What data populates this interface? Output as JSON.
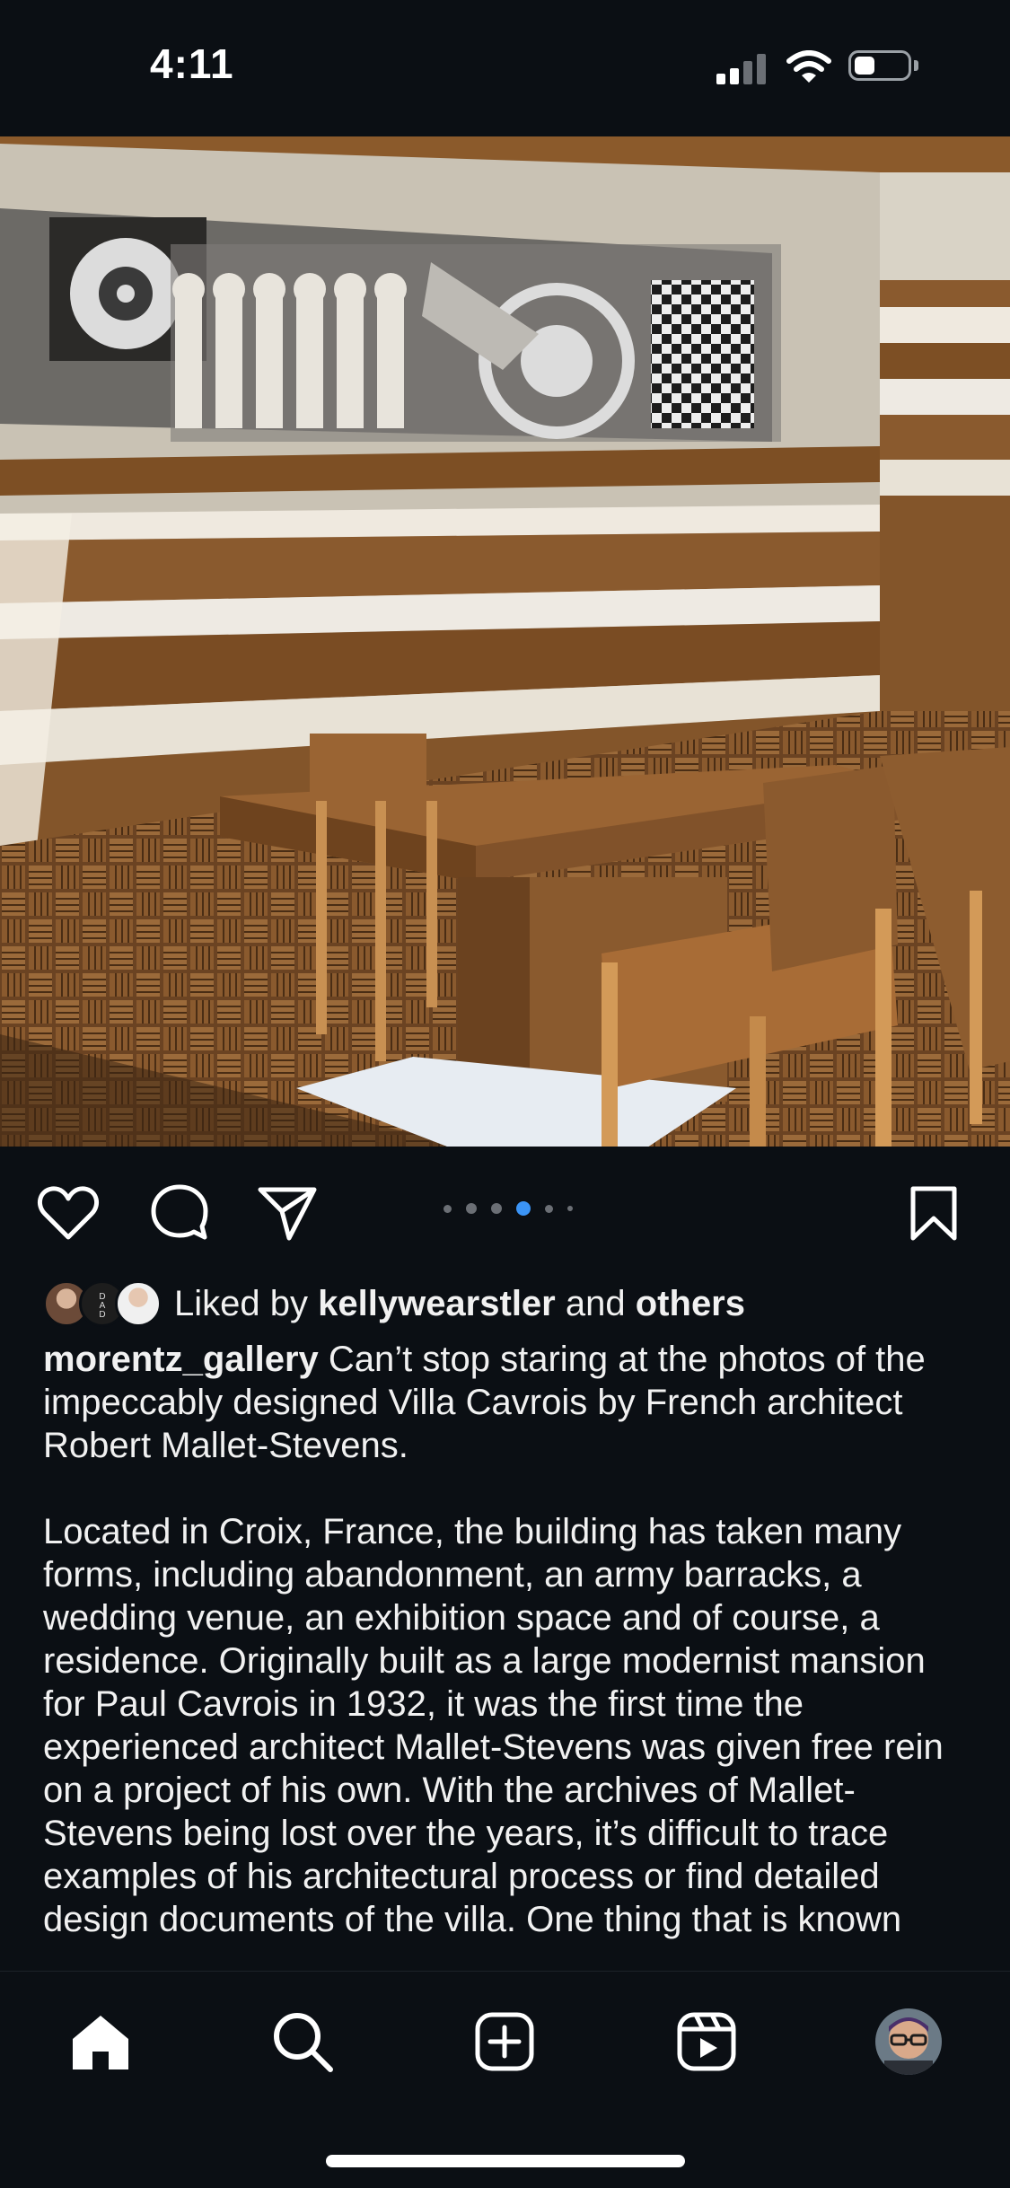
{
  "status_bar": {
    "time": "4:11",
    "icons": [
      "cellular-signal-icon",
      "wifi-icon",
      "battery-icon"
    ]
  },
  "post": {
    "carousel": {
      "slide_count": 6,
      "active_index": 3
    },
    "actions": {
      "icons": [
        "heart-icon",
        "comment-icon",
        "send-icon",
        "bookmark-icon"
      ]
    },
    "likes": {
      "prefix": "Liked by",
      "user": "kellywearstler",
      "joiner": "and",
      "others": "others",
      "avatar_icons": [
        "liker-avatar-1",
        "liker-avatar-2",
        "liker-avatar-3"
      ]
    },
    "caption": {
      "username": "morentz_gallery",
      "paragraph1": "Can’t stop staring at the photos of the impeccably designed Villa Cavrois by French architect Robert Mallet-Stevens.",
      "paragraph2": "Located in Croix, France, the building has taken many forms, including abandonment, an army barracks, a wedding venue, an exhibition space and of course, a residence. Originally built as a large modernist mansion for Paul Cavrois in 1932, it was the first time the experienced architect Mallet-Stevens was given free rein on a project of his own. With the archives of Mallet-Stevens being lost over the years, it’s difficult to trace examples of his architectural process or find detailed design documents of the villa. One thing that is known"
    }
  },
  "bottom_nav": {
    "items": [
      "home-icon",
      "search-icon",
      "create-icon",
      "reels-icon",
      "profile-avatar"
    ]
  },
  "colors": {
    "background": "#0b0f14",
    "text": "#f1f1f1",
    "accent_dot": "#3b94f6",
    "inactive_dot": "#6b6f75"
  }
}
